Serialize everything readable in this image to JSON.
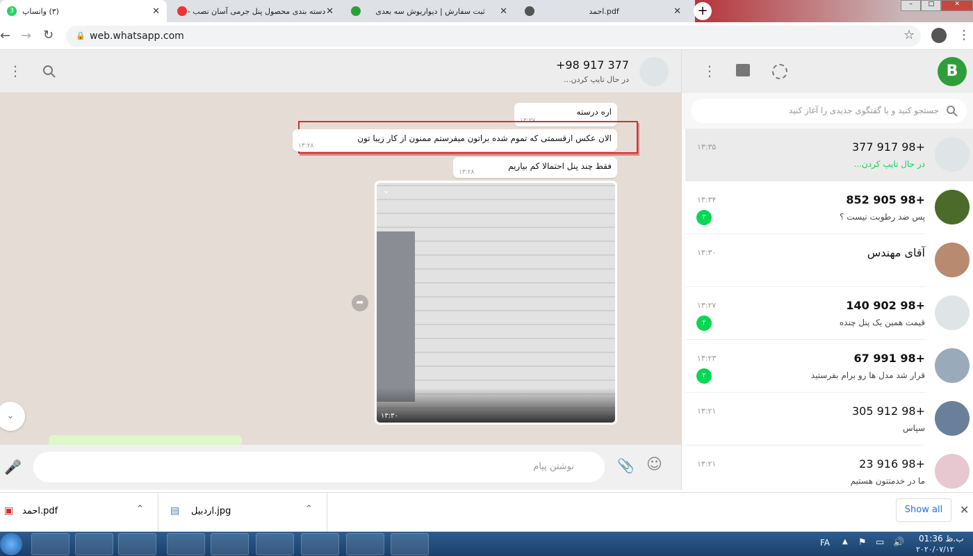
{
  "browser": {
    "tabs": [
      {
        "title": "(۳) واتساپ",
        "badge": "3",
        "active": true
      },
      {
        "title": "دسته بندی محصول پنل جرمی آسان نصب -",
        "active": false
      },
      {
        "title": "ثبت سفارش | دیواریوش سه بعدی",
        "active": false
      },
      {
        "title": "pdf.احمد",
        "active": false
      }
    ],
    "url": "web.whatsapp.com"
  },
  "chat": {
    "contact": "+98 917 377",
    "status": "در حال تایپ کردن...",
    "messages": [
      {
        "text": "اره درسته",
        "time": "۱۳:۲۷"
      },
      {
        "text": "الان عکس ازقسمتی که تموم شده براتون میفرستم ممنون از کار زیبا تون",
        "time": "۱۳:۲۸",
        "highlighted": true
      },
      {
        "text": "فقط چند پنل احتمالا کم بیاریم",
        "time": "۱۳:۲۸"
      }
    ],
    "image_time": "۱۳:۳۰",
    "input_placeholder": "نوشتن پیام"
  },
  "sidebar": {
    "search_placeholder": "جستجو کنید و یا گفتگوی جدیدی را آغاز کنید",
    "chats": [
      {
        "name": "+98 917 377",
        "preview": "در حال تایپ کردن...",
        "time": "۱۳:۳۵",
        "unread": "",
        "selected": true
      },
      {
        "name": "+98 905 852",
        "preview": "پس ضد رطوبت نیست ؟",
        "time": "۱۳:۳۴",
        "unread": "۲"
      },
      {
        "name": "آقای مهندس",
        "preview": "",
        "time": "۱۳:۳۰",
        "unread": ""
      },
      {
        "name": "+98 902 140",
        "preview": "قیمت همین یک پنل چنده",
        "time": "۱۳:۲۷",
        "unread": "۲"
      },
      {
        "name": "+98 991 67",
        "preview": "قرار شد مدل ها رو برام بفرستید",
        "time": "۱۳:۲۳",
        "unread": "۲"
      },
      {
        "name": "+98 912 305",
        "preview": "سپاس",
        "time": "۱۳:۲۱",
        "unread": ""
      },
      {
        "name": "+98 916 23",
        "preview": "ما در خدمتتون هستیم",
        "time": "۱۳:۲۱",
        "unread": ""
      }
    ]
  },
  "downloads": {
    "files": [
      {
        "name": "احمد.pdf"
      },
      {
        "name": "اردبیل.jpg"
      }
    ],
    "show_all": "Show all"
  },
  "taskbar": {
    "lang": "FA",
    "time": "01:36 ب.ظ",
    "date": "۲۰۲۰/۰۷/۱۲"
  },
  "colors": {
    "accent": "#06d755",
    "header": "#ededed",
    "chat_bg": "#e5ddd5",
    "highlight_border": "#d32f2f"
  }
}
